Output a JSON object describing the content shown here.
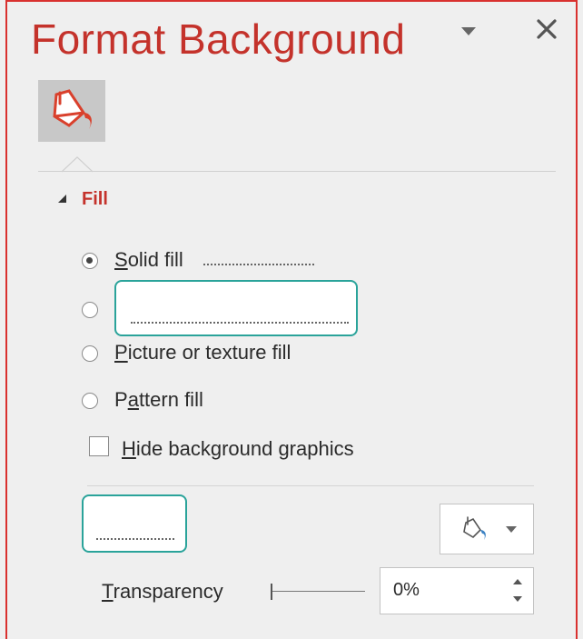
{
  "panel": {
    "title": "Format Background",
    "close_glyph": "✕"
  },
  "tabs": [
    {
      "name": "fill-tab",
      "icon": "paint-bucket-icon"
    }
  ],
  "fill_section": {
    "title": "Fill",
    "options": [
      {
        "prefix": "",
        "key": "S",
        "rest": "olid fill",
        "checked": true
      },
      {
        "prefix": "",
        "key": "",
        "rest": "",
        "checked": false,
        "blank": true
      },
      {
        "prefix": "",
        "key": "P",
        "rest": "icture or texture fill",
        "checked": false
      },
      {
        "prefix": "P",
        "key": "a",
        "rest": "ttern fill",
        "checked": false
      }
    ],
    "hide_graphics": {
      "key": "H",
      "rest": "ide background graphics",
      "checked": false
    }
  },
  "color": {
    "label_blank": true,
    "icon": "paint-bucket-icon"
  },
  "transparency": {
    "key": "T",
    "rest": "ransparency",
    "value": "0%"
  },
  "colors": {
    "accent": "#c4322b",
    "highlight_box": "#2aa39a",
    "panel_bg": "#efefef"
  }
}
